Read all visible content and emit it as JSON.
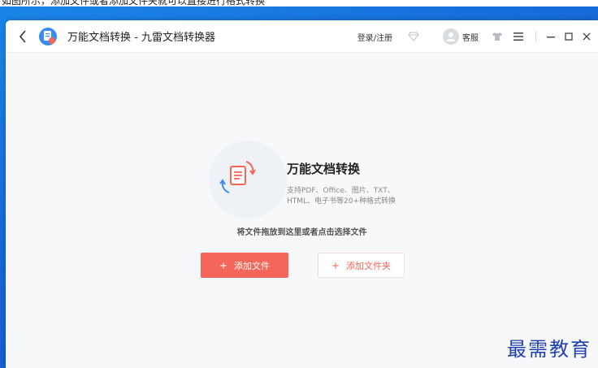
{
  "caption": {
    "text": "如图所示，添加文件或者添加文件夹就可以直接进行格式转换"
  },
  "titlebar": {
    "title": "万能文档转换 - 九雷文档转换器",
    "login_label": "登录/注册",
    "cs_label": "客服"
  },
  "hero": {
    "title": "万能文档转换",
    "desc_line1": "支持PDF、Office、图片、TXT、",
    "desc_line2": "HTML、电子书等20+种格式转换"
  },
  "drop_hint": "将文件拖放到这里或者点击选择文件",
  "buttons": {
    "add_file_plus": "+",
    "add_file": "添加文件",
    "add_folder_plus": "+",
    "add_folder": "添加文件夹"
  },
  "watermark": "最需教育",
  "colors": {
    "accent": "#f4665a",
    "desktop": "#1566d6",
    "window_bg": "#f7f8fa"
  },
  "icons": [
    "back-arrow-icon",
    "app-logo-icon",
    "vip-diamond-icon",
    "customer-service-avatar-icon",
    "skin-shirt-icon",
    "menu-icon",
    "minimize-icon",
    "maximize-icon",
    "close-icon",
    "document-convert-icon"
  ]
}
